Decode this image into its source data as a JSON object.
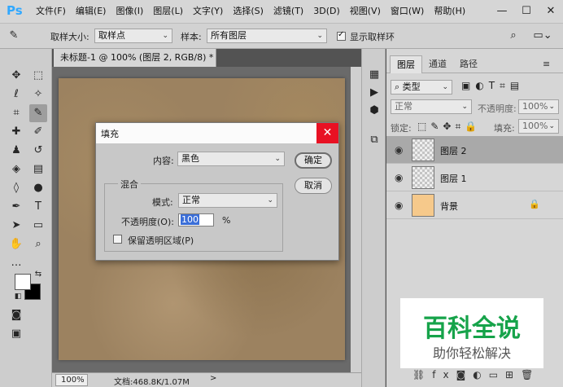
{
  "menubar": {
    "logo": "Ps",
    "items": [
      "文件(F)",
      "编辑(E)",
      "图像(I)",
      "图层(L)",
      "文字(Y)",
      "选择(S)",
      "滤镜(T)",
      "3D(D)",
      "视图(V)",
      "窗口(W)",
      "帮助(H)"
    ],
    "window_controls": {
      "minimize": "—",
      "maximize": "☐",
      "close": "✕"
    }
  },
  "options": {
    "sample_size_label": "取样大小:",
    "sample_size_value": "取样点",
    "sample_label": "样本:",
    "sample_value": "所有图层",
    "show_ring_label": "显示取样环",
    "show_ring_checked": true
  },
  "document": {
    "tab_title": "未标题-1 @ 100% (图层 2, RGB/8) *",
    "tab_close": "×",
    "zoom": "100%",
    "doc_info": "文档:468.8K/1.07M",
    "status_arrow": ">"
  },
  "layers_panel": {
    "tabs": [
      "图层",
      "通道",
      "路径"
    ],
    "kind_filter": "类型",
    "blend_mode": "正常",
    "opacity_label": "不透明度:",
    "opacity_value": "100%",
    "lock_label": "锁定:",
    "fill_label": "填充:",
    "fill_value": "100%",
    "layers": [
      {
        "name": "图层 2",
        "selected": true,
        "type": "transparent"
      },
      {
        "name": "图层 1",
        "selected": false,
        "type": "transparent"
      },
      {
        "name": "背景",
        "selected": false,
        "type": "background",
        "locked": true
      }
    ],
    "bottom_icons": [
      "link-icon",
      "fx-icon",
      "mask-icon",
      "adjustment-icon",
      "group-icon",
      "new-layer-icon",
      "delete-icon"
    ]
  },
  "dialog": {
    "title": "填充",
    "close": "✕",
    "contents_label": "内容:",
    "contents_value": "黑色",
    "ok_label": "确定",
    "cancel_label": "取消",
    "blending_legend": "混合",
    "mode_label": "模式:",
    "mode_value": "正常",
    "opacity_label": "不透明度(O):",
    "opacity_value": "100",
    "opacity_unit": "%",
    "preserve_label": "保留透明区域(P)",
    "preserve_checked": false
  },
  "watermark": {
    "title": "百科全说",
    "subtitle": "助你轻松解决"
  },
  "colors": {
    "canvas": "#9c8260",
    "dialog_close": "#e81123",
    "watermark_title": "#16a34a",
    "selection_highlight": "#3a6ed8"
  }
}
